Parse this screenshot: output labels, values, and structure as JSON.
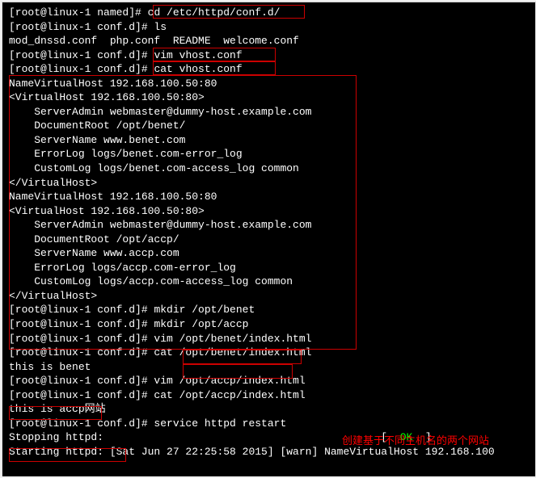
{
  "lines": {
    "l1_prompt": "[root@linux-1 named]# ",
    "l1_cmd": "cd /etc/httpd/conf.d/",
    "l2": "[root@linux-1 conf.d]# ls",
    "l3": "mod_dnssd.conf  php.conf  README  welcome.conf",
    "l4_prompt": "[root@linux-1 conf.d]# ",
    "l4_cmd": "vim vhost.conf",
    "l5_prompt": "[root@linux-1 conf.d]# ",
    "l5_cmd": "cat vhost.conf",
    "l6": "NameVirtualHost 192.168.100.50:80",
    "l7": "<VirtualHost 192.168.100.50:80>",
    "l8": "    ServerAdmin webmaster@dummy-host.example.com",
    "l9": "    DocumentRoot /opt/benet/",
    "l10": "    ServerName www.benet.com",
    "l11": "    ErrorLog logs/benet.com-error_log",
    "l12": "    CustomLog logs/benet.com-access_log common",
    "l13": "</VirtualHost>",
    "l14": "",
    "l15": "NameVirtualHost 192.168.100.50:80",
    "l16": "<VirtualHost 192.168.100.50:80>",
    "l17": "    ServerAdmin webmaster@dummy-host.example.com",
    "l18": "    DocumentRoot /opt/accp/",
    "l19": "    ServerName www.accp.com",
    "l20": "    ErrorLog logs/accp.com-error_log",
    "l21": "    CustomLog logs/accp.com-access_log common",
    "l22": "</VirtualHost>",
    "l23_prompt": "[root@linux-1 conf.d]# ",
    "l23_cmd": "mkdir /opt/benet",
    "l24_prompt": "[root@linux-1 conf.d]# ",
    "l24_cmd": "mkdir /opt/accp",
    "l25": "[root@linux-1 conf.d]# vim /opt/benet/index.html",
    "l26": "[root@linux-1 conf.d]# cat /opt/benet/index.html",
    "l27": "this is benet",
    "l28": "[root@linux-1 conf.d]# vim /opt/accp/index.html",
    "l29": "[root@linux-1 conf.d]# cat /opt/accp/index.html",
    "l30": "this is accp网站",
    "l31": "[root@linux-1 conf.d]# service httpd restart",
    "l32a": "Stopping httpd:                                            [  ",
    "l32_ok": "OK",
    "l32b": "  ]",
    "l33": "Starting httpd: [Sat Jun 27 22:25:58 2015] [warn] NameVirtualHost 192.168.100"
  },
  "annotation": "创建基于不同主机名的两个网站"
}
